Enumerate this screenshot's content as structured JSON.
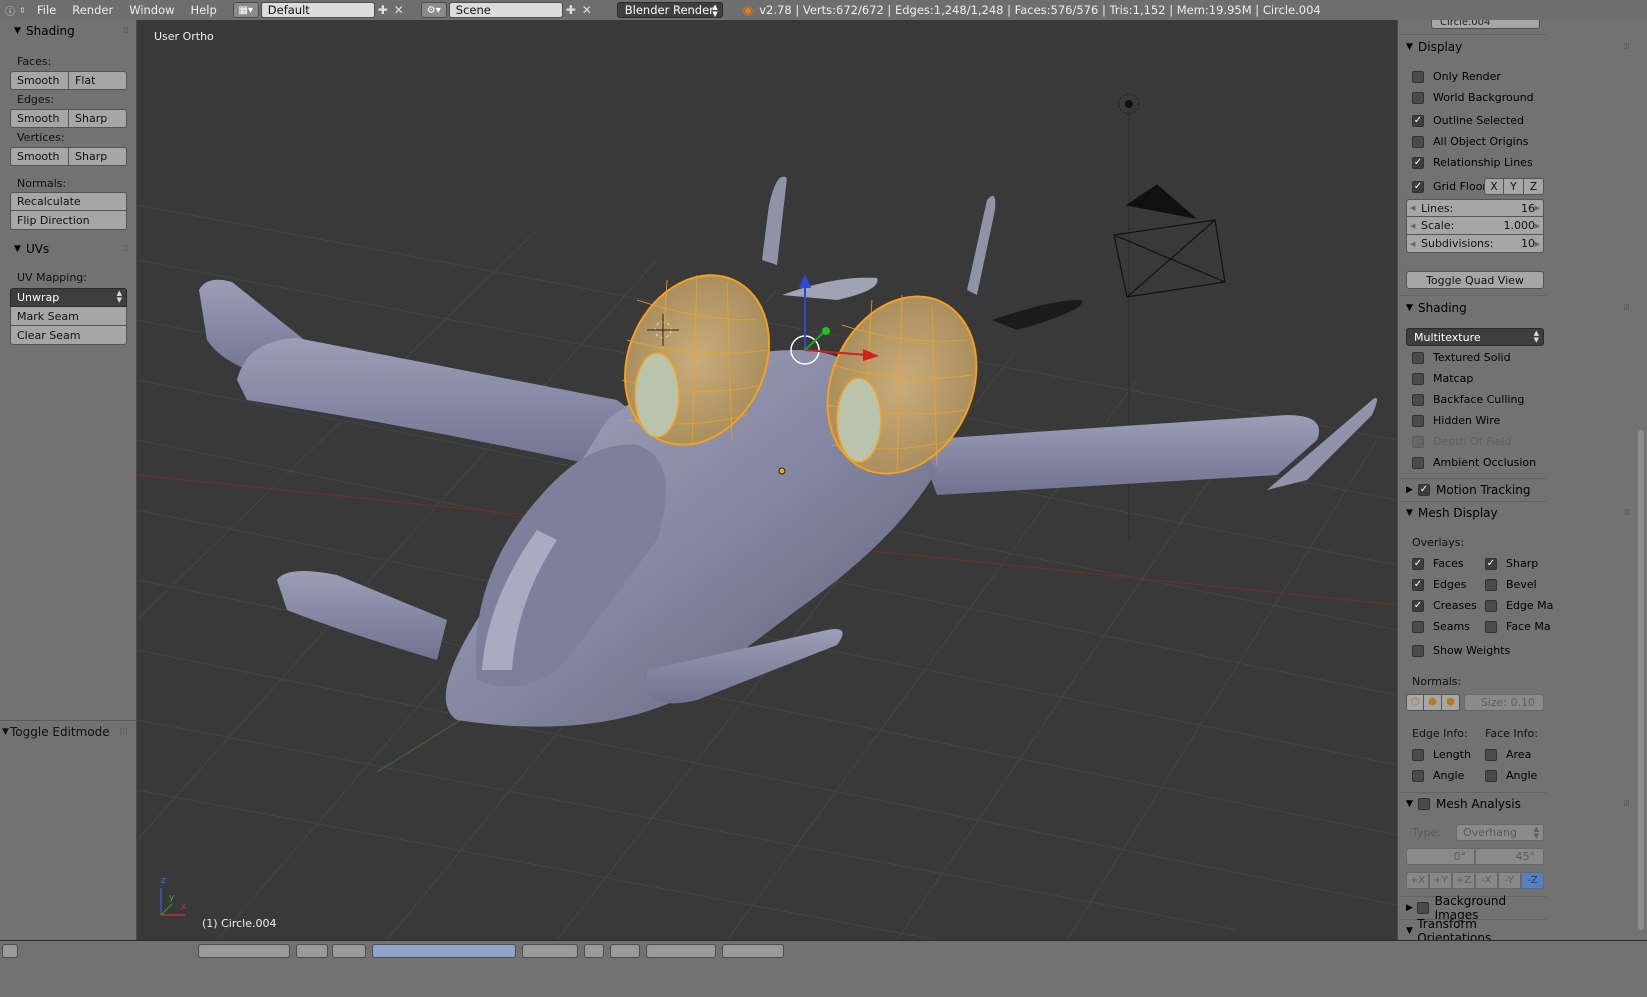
{
  "topbar": {
    "menus": [
      "File",
      "Render",
      "Window",
      "Help"
    ],
    "screen_layout": "Default",
    "scene": "Scene",
    "renderer": "Blender Render",
    "stats": "v2.78 | Verts:672/672 | Edges:1,248/1,248 | Faces:576/576 | Tris:1,152 | Mem:19.95M | Circle.004"
  },
  "toolshelf": {
    "shading_panel": {
      "title": "Shading",
      "faces_label": "Faces:",
      "faces_buttons": [
        "Smooth",
        "Flat"
      ],
      "edges_label": "Edges:",
      "edges_buttons": [
        "Smooth",
        "Sharp"
      ],
      "vertices_label": "Vertices:",
      "vertices_buttons": [
        "Smooth",
        "Sharp"
      ],
      "normals_label": "Normals:",
      "normals_buttons": [
        "Recalculate",
        "Flip Direction"
      ]
    },
    "uvs_panel": {
      "title": "UVs",
      "uv_mapping_label": "UV Mapping:",
      "uv_mapping_value": "Unwrap",
      "buttons": [
        "Mark Seam",
        "Clear Seam"
      ]
    },
    "operator_panel": "Toggle Editmode"
  },
  "viewport": {
    "view_label": "User Ortho",
    "object_label": "(1) Circle.004",
    "axis_labels": {
      "z": "z",
      "y": "y",
      "x": "x"
    }
  },
  "properties": {
    "top_field": "Circle.004",
    "display": {
      "title": "Display",
      "options": [
        {
          "label": "Only Render",
          "checked": false
        },
        {
          "label": "World Background",
          "checked": false
        },
        {
          "label": "Outline Selected",
          "checked": true
        },
        {
          "label": "All Object Origins",
          "checked": false
        },
        {
          "label": "Relationship Lines",
          "checked": true
        }
      ],
      "grid_floor": {
        "label": "Grid Floor",
        "checked": true,
        "axes": [
          "X",
          "Y",
          "Z"
        ]
      },
      "lines": {
        "label": "Lines:",
        "value": "16"
      },
      "scale": {
        "label": "Scale:",
        "value": "1.000"
      },
      "subdivisions": {
        "label": "Subdivisions:",
        "value": "10"
      },
      "toggle_quad_view": "Toggle Quad View"
    },
    "shading": {
      "title": "Shading",
      "mode": "Multitexture",
      "options": [
        {
          "label": "Textured Solid",
          "checked": false,
          "enabled": true
        },
        {
          "label": "Matcap",
          "checked": false,
          "enabled": true
        },
        {
          "label": "Backface Culling",
          "checked": false,
          "enabled": true
        },
        {
          "label": "Hidden Wire",
          "checked": false,
          "enabled": true
        },
        {
          "label": "Depth Of Field",
          "checked": false,
          "enabled": false
        },
        {
          "label": "Ambient Occlusion",
          "checked": false,
          "enabled": true
        }
      ]
    },
    "motion_tracking": {
      "title": "Motion Tracking",
      "checked": true
    },
    "mesh_display": {
      "title": "Mesh Display",
      "overlays_label": "Overlays:",
      "left_col": [
        {
          "label": "Faces",
          "checked": true
        },
        {
          "label": "Edges",
          "checked": true
        },
        {
          "label": "Creases",
          "checked": true
        },
        {
          "label": "Seams",
          "checked": false
        }
      ],
      "right_col": [
        {
          "label": "Sharp",
          "checked": true
        },
        {
          "label": "Bevel",
          "checked": false
        },
        {
          "label": "Edge Ma",
          "checked": false
        },
        {
          "label": "Face Ma",
          "checked": false
        }
      ],
      "show_weights": {
        "label": "Show Weights",
        "checked": false
      },
      "normals_label": "Normals:",
      "normals_size": "Size:  0.10",
      "edge_info_label": "Edge Info:",
      "face_info_label": "Face Info:",
      "edge_info": [
        {
          "label": "Length",
          "checked": false
        },
        {
          "label": "Angle",
          "checked": false
        }
      ],
      "face_info": [
        {
          "label": "Area",
          "checked": false
        },
        {
          "label": "Angle",
          "checked": false
        }
      ]
    },
    "mesh_analysis": {
      "title": "Mesh Analysis",
      "checked": false,
      "type_label": "Type:",
      "type_value": "Overhang",
      "min": "0°",
      "max": "45°",
      "axes": [
        "+X",
        "+Y",
        "+Z",
        "-X",
        "-Y",
        "-Z"
      ],
      "selected_axis": "-Z"
    },
    "background_images": {
      "title": "Background Images",
      "checked": false
    },
    "transform_orientations": {
      "title": "Transform Orientations"
    }
  },
  "colors": {
    "panel_bg": "#727272",
    "viewport_bg": "#393939",
    "selection_orange": "#f5a020",
    "mesh_gray": "#8a8ea8"
  }
}
